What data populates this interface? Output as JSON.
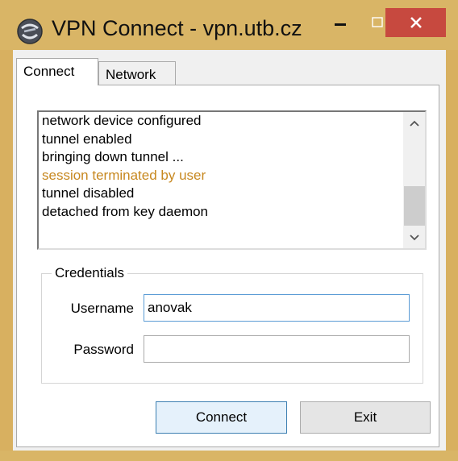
{
  "window": {
    "title": "VPN Connect - vpn.utb.cz",
    "frame_color": "#d9b566",
    "close_color": "#c7493f"
  },
  "tabs": [
    {
      "label": "Connect",
      "active": true
    },
    {
      "label": "Network",
      "active": false
    }
  ],
  "log": {
    "lines": [
      {
        "text": "network device configured",
        "color": "#000000"
      },
      {
        "text": "tunnel enabled",
        "color": "#000000"
      },
      {
        "text": "bringing down tunnel ...",
        "color": "#000000"
      },
      {
        "text": "session terminated by user",
        "color": "#c78820"
      },
      {
        "text": "tunnel disabled",
        "color": "#000000"
      },
      {
        "text": "detached from key daemon",
        "color": "#000000"
      }
    ]
  },
  "credentials": {
    "legend": "Credentials",
    "username_label": "Username",
    "username_value": "anovak",
    "password_label": "Password",
    "password_value": ""
  },
  "buttons": {
    "connect": "Connect",
    "exit": "Exit"
  },
  "icons": {
    "app": "vpn-globe-icon",
    "minimize": "minimize-icon",
    "maximize": "maximize-icon",
    "close": "close-icon",
    "scroll_up": "chevron-up-icon",
    "scroll_down": "chevron-down-icon"
  }
}
